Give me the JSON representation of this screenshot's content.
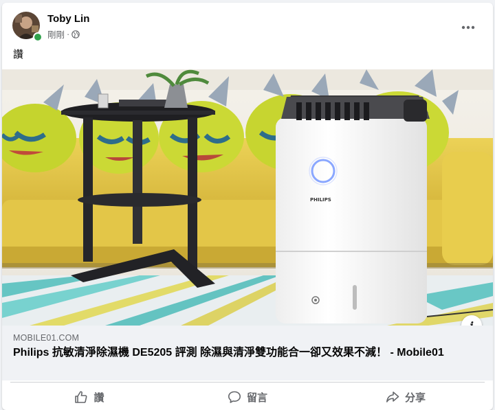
{
  "post": {
    "author": "Toby Lin",
    "time": "剛剛",
    "separator": "·",
    "privacy_icon": "globe-icon",
    "text": "讚",
    "more_icon": "more-horizontal-icon"
  },
  "link": {
    "image_subject": "Philips dehumidifier beside side table and yellow sofa",
    "product_brand": "PHILIPS",
    "domain": "MOBILE01.COM",
    "title": "Philips 抗敏清淨除濕機 DE5205 評測 除濕與清淨雙功能合一卻又效果不減！ - Mobile01",
    "info_icon": "info-icon"
  },
  "actions": {
    "like_label": "讚",
    "comment_label": "留言",
    "share_label": "分享"
  },
  "colors": {
    "background": "#f0f2f5",
    "secondary_text": "#65676b",
    "online": "#31a24c",
    "sofa_yellow": "#e7cc47",
    "monster_green": "#c8d630"
  }
}
